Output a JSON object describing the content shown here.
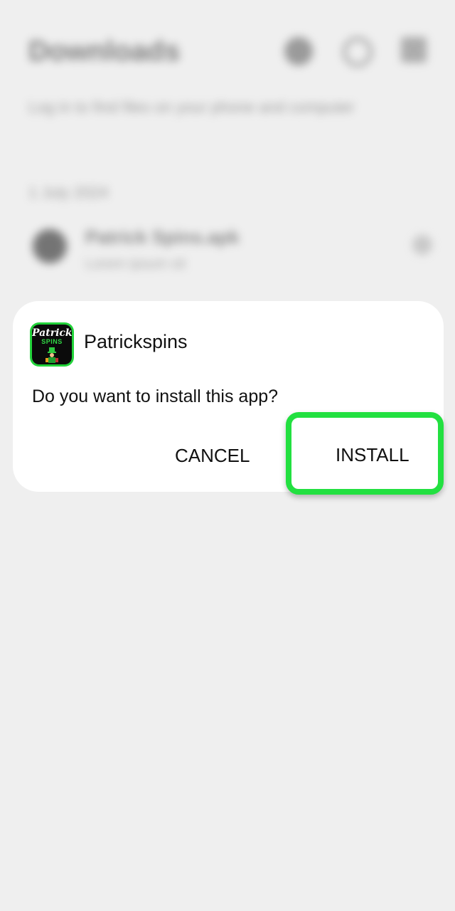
{
  "background": {
    "title": "Downloads",
    "subtitle": "Log in to find files on your phone and computer",
    "section": "1 July 2024",
    "item_title": "Patrick Spins.apk",
    "item_sub": "Lorem ipsum sit"
  },
  "dialog": {
    "app_icon": "patrickspins-logo-icon",
    "logo_line1": "Patrick",
    "logo_line2": "SPINS",
    "app_name": "Patrickspins",
    "question": "Do you want to install this app?",
    "cancel_label": "CANCEL",
    "install_label": "INSTALL",
    "highlight_color": "#22e040"
  }
}
